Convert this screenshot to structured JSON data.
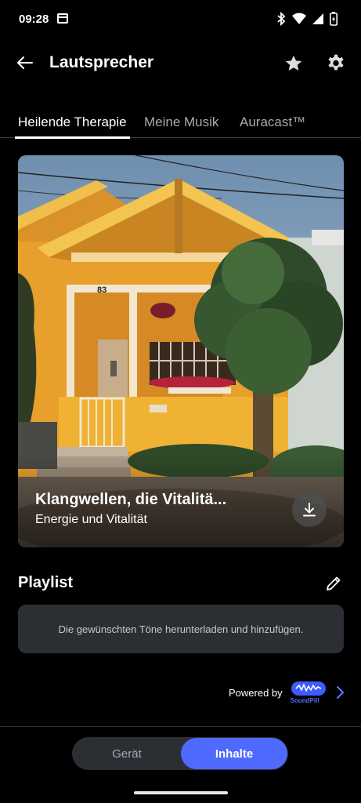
{
  "status_bar": {
    "time": "09:28",
    "icons": [
      "calendar-icon",
      "bluetooth-icon",
      "wifi-icon",
      "signal-icon",
      "battery-icon"
    ]
  },
  "app_bar": {
    "title": "Lautsprecher",
    "icons": [
      "back-arrow-icon",
      "star-icon",
      "gear-icon"
    ]
  },
  "tabs": [
    {
      "label": "Heilende Therapie",
      "active": true
    },
    {
      "label": "Meine Musik",
      "active": false
    },
    {
      "label": "Auracast™",
      "active": false
    }
  ],
  "hero": {
    "title": "Klangwellen, die Vitalitä...",
    "subtitle": "Energie und Vitalität",
    "house_number": "83",
    "download_icon": "download-icon"
  },
  "playlist": {
    "heading": "Playlist",
    "empty_message": "Die gewünschten Töne herunterladen und hinzufügen.",
    "edit_icon": "pencil-icon"
  },
  "powered_by": {
    "text": "Powered by",
    "brand": "SoundPill"
  },
  "bottom_nav": {
    "device_label": "Gerät",
    "content_label": "Inhalte",
    "selected": "Inhalte"
  },
  "colors": {
    "accent": "#4f6bff",
    "background": "#000000",
    "card": "#2b2e33",
    "inactive_text": "#a7abb3",
    "house_yellow": "#e9a42a"
  }
}
